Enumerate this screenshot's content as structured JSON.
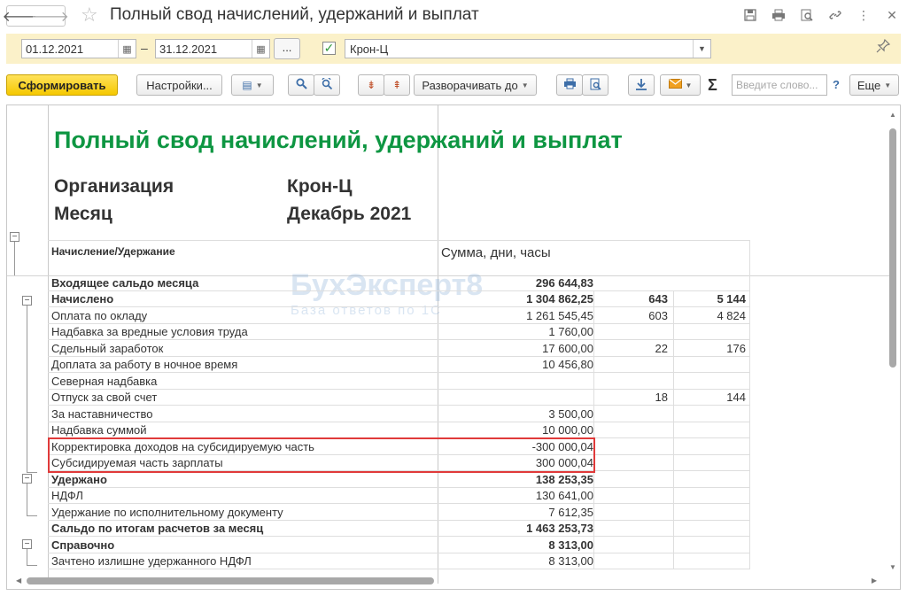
{
  "window": {
    "title": "Полный свод начислений, удержаний и выплат"
  },
  "filters": {
    "date_from": "01.12.2021",
    "date_to": "31.12.2021",
    "dash": "–",
    "period_button": "...",
    "organization": "Крон-Ц",
    "organization_checked": true
  },
  "toolbar": {
    "generate": "Сформировать",
    "settings": "Настройки...",
    "expand_to": "Разворачивать до",
    "search_placeholder": "Введите слово...",
    "help": "?",
    "more": "Еще"
  },
  "report": {
    "title": "Полный свод начислений, удержаний и выплат",
    "org_label": "Организация",
    "org_value": "Крон-Ц",
    "month_label": "Месяц",
    "month_value": "Декабрь 2021",
    "col_header_1": "Начисление/Удержание",
    "col_header_2": "Сумма, дни, часы",
    "rows": [
      {
        "name": "Входящее сальдо месяца",
        "sum": "296 644,83",
        "days": "",
        "hours": "",
        "bold": true
      },
      {
        "name": "Начислено",
        "sum": "1 304 862,25",
        "days": "643",
        "hours": "5 144",
        "bold": true
      },
      {
        "name": "Оплата по окладу",
        "sum": "1 261 545,45",
        "days": "603",
        "hours": "4 824",
        "bold": false
      },
      {
        "name": "Надбавка за вредные условия труда",
        "sum": "1 760,00",
        "days": "",
        "hours": "",
        "bold": false
      },
      {
        "name": "Сдельный заработок",
        "sum": "17 600,00",
        "days": "22",
        "hours": "176",
        "bold": false
      },
      {
        "name": "Доплата за работу в ночное время",
        "sum": "10 456,80",
        "days": "",
        "hours": "",
        "bold": false
      },
      {
        "name": "Северная надбавка",
        "sum": "",
        "days": "",
        "hours": "",
        "bold": false
      },
      {
        "name": "Отпуск за свой счет",
        "sum": "",
        "days": "18",
        "hours": "144",
        "bold": false
      },
      {
        "name": "За наставничество",
        "sum": "3 500,00",
        "days": "",
        "hours": "",
        "bold": false
      },
      {
        "name": "Надбавка суммой",
        "sum": "10 000,00",
        "days": "",
        "hours": "",
        "bold": false
      },
      {
        "name": "Корректировка доходов на субсидируемую часть",
        "sum": "-300 000,04",
        "days": "",
        "hours": "",
        "bold": false
      },
      {
        "name": "Субсидируемая часть зарплаты",
        "sum": "300 000,04",
        "days": "",
        "hours": "",
        "bold": false
      },
      {
        "name": "Удержано",
        "sum": "138 253,35",
        "days": "",
        "hours": "",
        "bold": true
      },
      {
        "name": "НДФЛ",
        "sum": "130 641,00",
        "days": "",
        "hours": "",
        "bold": false
      },
      {
        "name": "Удержание по исполнительному документу",
        "sum": "7 612,35",
        "days": "",
        "hours": "",
        "bold": false
      },
      {
        "name": "Сальдо по итогам расчетов за месяц",
        "sum": "1 463 253,73",
        "days": "",
        "hours": "",
        "bold": true
      },
      {
        "name": "Справочно",
        "sum": "8 313,00",
        "days": "",
        "hours": "",
        "bold": true
      },
      {
        "name": "Зачтено излишне удержанного НДФЛ",
        "sum": "8 313,00",
        "days": "",
        "hours": "",
        "bold": false
      }
    ]
  },
  "watermark": {
    "brand": "БухЭксперт8",
    "tagline": "База ответов по 1С"
  },
  "colors": {
    "report_title": "#0e9642",
    "filter_bar": "#fbf1c9",
    "primary_button": "#f5c800",
    "highlight": "#e03a3a"
  }
}
